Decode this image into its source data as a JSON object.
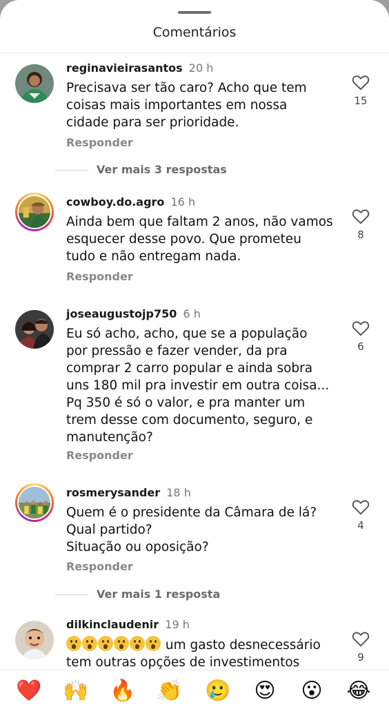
{
  "header": {
    "title": "Comentários"
  },
  "comments": [
    {
      "username": "reginavieirasantos",
      "time": "20 h",
      "lines": [
        "Precisava ser tão caro? Acho que tem",
        "coisas mais importantes em nossa",
        "cidade para ser prioridade."
      ],
      "likes": "15",
      "reply_label": "Responder",
      "more_replies": "Ver mais 3 respostas"
    },
    {
      "username": "cowboy.do.agro",
      "time": "16 h",
      "lines": [
        "Ainda bem que faltam 2 anos, não vamos",
        "esquecer desse povo. Que prometeu",
        "tudo e não entregam nada."
      ],
      "likes": "8",
      "reply_label": "Responder"
    },
    {
      "username": "joseaugustojp750",
      "time": "6 h",
      "lines": [
        "Eu só acho, acho, que se a população",
        "por pressão e fazer vender, da pra",
        "comprar 2 carro popular e ainda sobra",
        "uns 180 mil pra investir em outra coisa...",
        "Pq 350 é só o valor, e pra manter um",
        "trem desse com documento, seguro, e",
        "manutenção?"
      ],
      "likes": "6",
      "reply_label": "Responder"
    },
    {
      "username": "rosmerysander",
      "time": "18 h",
      "lines": [
        "Quem é o presidente da Câmara de lá?",
        "Qual partido?",
        "Situação ou oposição?"
      ],
      "likes": "4",
      "reply_label": "Responder",
      "more_replies": "Ver mais 1 resposta"
    },
    {
      "username": "dilkinclaudenir",
      "time": "19 h",
      "lines_after_emoji": "um gasto desnecessário",
      "line2": "tem outras opções de investimentos",
      "emoji_icon": "face-with-open-mouth-emoji",
      "emoji_count": 6,
      "likes": "9"
    }
  ],
  "reaction_bar": [
    {
      "icon": "red-heart-emoji",
      "glyph": "❤️"
    },
    {
      "icon": "raising-hands-emoji",
      "glyph": "🙌"
    },
    {
      "icon": "fire-emoji",
      "glyph": "🔥"
    },
    {
      "icon": "clapping-hands-emoji",
      "glyph": "👏"
    },
    {
      "icon": "crying-face-emoji",
      "glyph": "🥲"
    },
    {
      "icon": "heart-eyes-emoji",
      "glyph": "😍"
    },
    {
      "icon": "open-mouth-emoji",
      "glyph": "😮"
    },
    {
      "icon": "tears-of-joy-emoji",
      "glyph": "😂"
    }
  ]
}
